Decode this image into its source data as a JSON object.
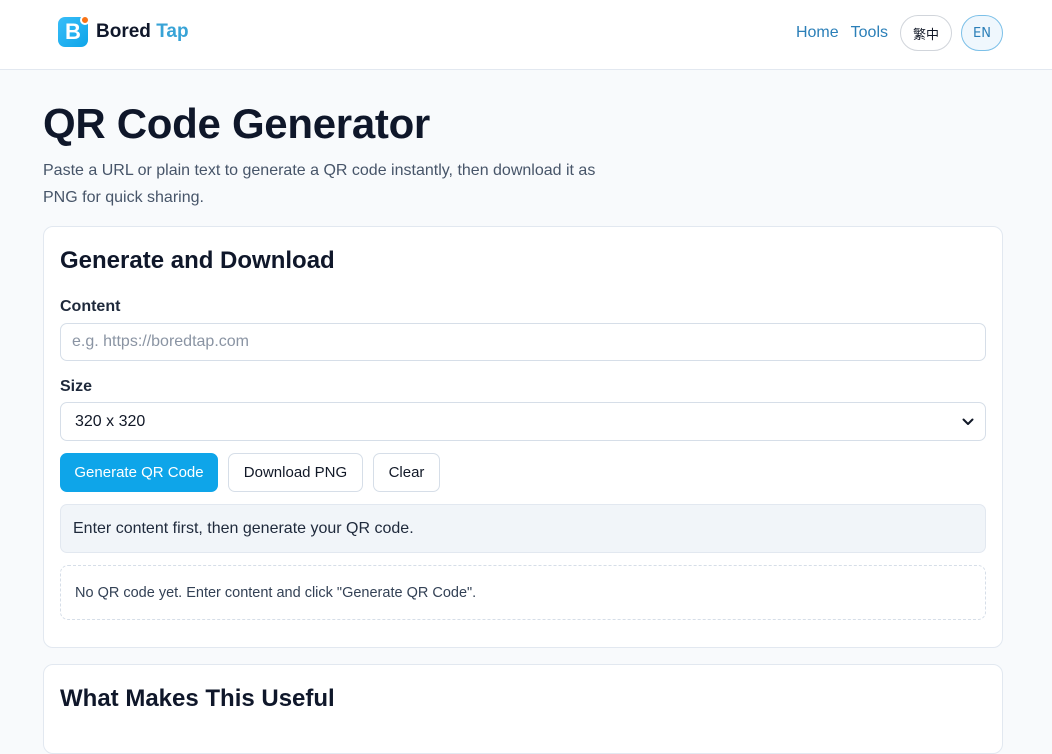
{
  "header": {
    "logo_initial": "B",
    "brand_primary": "Bored",
    "brand_accent": "Tap",
    "nav": [
      {
        "label": "Home"
      },
      {
        "label": "Tools"
      }
    ],
    "lang_zh": "繁中",
    "lang_en": "EN",
    "active_lang": "EN"
  },
  "page": {
    "title": "QR Code Generator",
    "description": "Paste a URL or plain text to generate a QR code instantly, then download it as PNG for quick sharing."
  },
  "generator": {
    "title": "Generate and Download",
    "content_label": "Content",
    "content_placeholder": "e.g. https://boredtap.com",
    "content_value": "",
    "size_label": "Size",
    "size_selected": "320 x 320",
    "buttons": {
      "generate": "Generate QR Code",
      "download": "Download PNG",
      "clear": "Clear"
    },
    "status_message": "Enter content first, then generate your QR code.",
    "preview_empty": "No QR code yet. Enter content and click \"Generate QR Code\"."
  },
  "features": {
    "title": "What Makes This Useful"
  },
  "colors": {
    "accent": "#0ea5e9",
    "link": "#2b7fb8",
    "background": "#f8fafc",
    "logo_dot": "#f97316"
  },
  "icons": {
    "select_arrow": "chevron-down-icon",
    "logo": "logo-icon"
  }
}
